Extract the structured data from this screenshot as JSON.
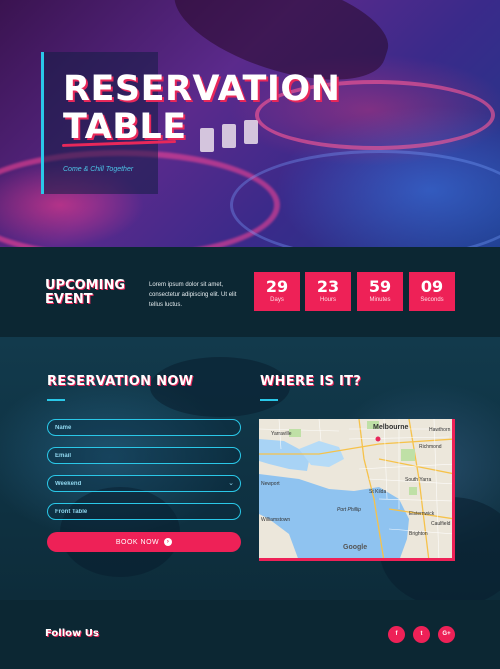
{
  "hero": {
    "title_line1": "RESERVATION",
    "title_line2": "TABLE",
    "subtitle": "Come & Chill Together"
  },
  "event": {
    "title_line1": "UPCOMING",
    "title_line2": "EVENT",
    "description": "Lorem ipsum dolor sit amet, consectetur adipiscing elit. Ut elit tellus luctus.",
    "countdown": [
      {
        "value": "29",
        "unit": "Days"
      },
      {
        "value": "23",
        "unit": "Hours"
      },
      {
        "value": "59",
        "unit": "Minutes"
      },
      {
        "value": "09",
        "unit": "Seconds"
      }
    ]
  },
  "reservation": {
    "title": "RESERVATION NOW",
    "fields": {
      "name_placeholder": "Name",
      "email_placeholder": "Email",
      "weekend_value": "Weekend",
      "table_placeholder": "Front Table"
    },
    "button_label": "BOOK NOW",
    "button_icon": "arrow-right-circle-icon"
  },
  "location": {
    "title": "WHERE IS IT?",
    "map_labels": {
      "melbourne": "Melbourne",
      "yarraville": "Yarraville",
      "williamstown": "Williamstown",
      "newport": "Newport",
      "st_kilda": "St Kilda",
      "port_phillip": "Port Phillip",
      "brighton": "Brighton",
      "south_yarra": "South Yarra",
      "richmond": "Richmond",
      "hawthorn": "Hawthorn",
      "elsternwick": "Elsternwick",
      "caulfield": "Caulfield",
      "google": "Google"
    }
  },
  "footer": {
    "follow_label": "Follow Us",
    "social": [
      {
        "icon": "facebook-icon",
        "glyph": "f"
      },
      {
        "icon": "twitter-icon",
        "glyph": "t"
      },
      {
        "icon": "google-plus-icon",
        "glyph": "G+"
      }
    ]
  },
  "colors": {
    "accent": "#ee2157",
    "cyan": "#2ac8e8",
    "dark_bg": "#0c2733"
  }
}
